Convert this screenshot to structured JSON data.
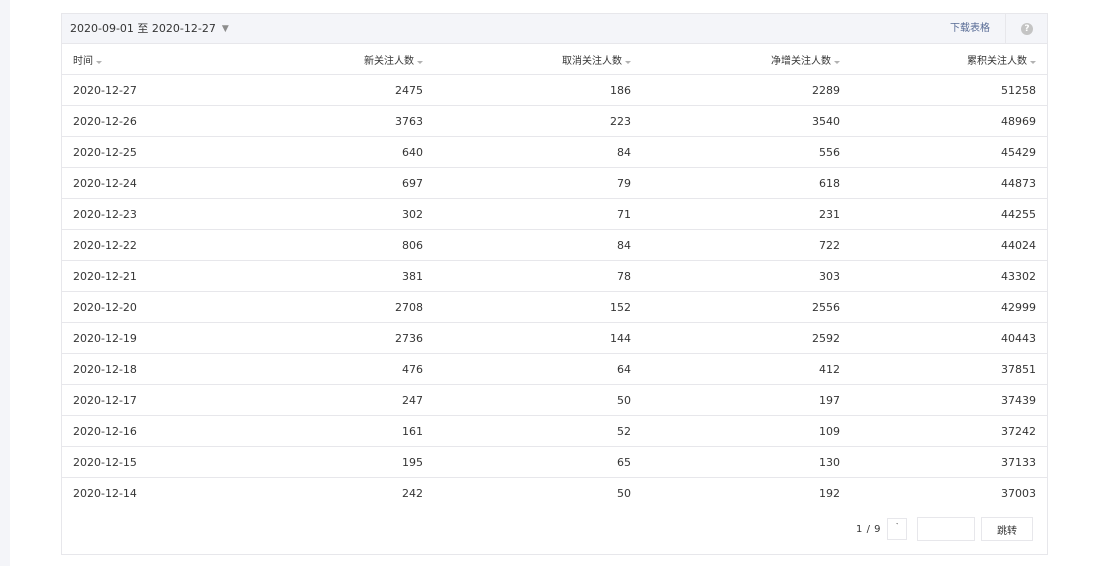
{
  "toolbar": {
    "date_range": "2020-09-01 至 2020-12-27",
    "caret": "▼",
    "download_label": "下载表格",
    "help_glyph": "?"
  },
  "table": {
    "columns": [
      "时间",
      "新关注人数",
      "取消关注人数",
      "净增关注人数",
      "累积关注人数"
    ],
    "rows": [
      [
        "2020-12-27",
        "2475",
        "186",
        "2289",
        "51258"
      ],
      [
        "2020-12-26",
        "3763",
        "223",
        "3540",
        "48969"
      ],
      [
        "2020-12-25",
        "640",
        "84",
        "556",
        "45429"
      ],
      [
        "2020-12-24",
        "697",
        "79",
        "618",
        "44873"
      ],
      [
        "2020-12-23",
        "302",
        "71",
        "231",
        "44255"
      ],
      [
        "2020-12-22",
        "806",
        "84",
        "722",
        "44024"
      ],
      [
        "2020-12-21",
        "381",
        "78",
        "303",
        "43302"
      ],
      [
        "2020-12-20",
        "2708",
        "152",
        "2556",
        "42999"
      ],
      [
        "2020-12-19",
        "2736",
        "144",
        "2592",
        "40443"
      ],
      [
        "2020-12-18",
        "476",
        "64",
        "412",
        "37851"
      ],
      [
        "2020-12-17",
        "247",
        "50",
        "197",
        "37439"
      ],
      [
        "2020-12-16",
        "161",
        "52",
        "109",
        "37242"
      ],
      [
        "2020-12-15",
        "195",
        "65",
        "130",
        "37133"
      ],
      [
        "2020-12-14",
        "242",
        "50",
        "192",
        "37003"
      ]
    ]
  },
  "pagination": {
    "page_info": "1 / 9",
    "next_glyph": "˺",
    "jump_value": "",
    "jump_label": "跳转"
  }
}
